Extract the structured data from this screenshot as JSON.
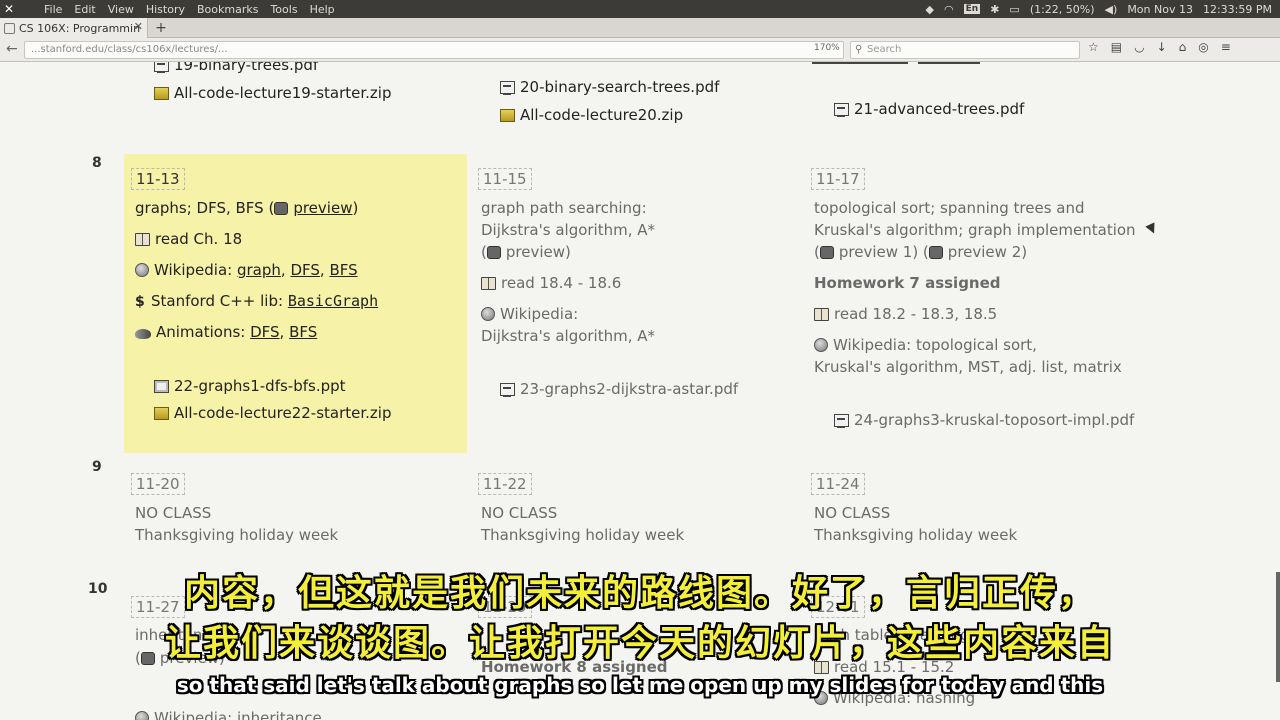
{
  "system": {
    "menu": [
      "File",
      "Edit",
      "View",
      "History",
      "Bookmarks",
      "Tools",
      "Help"
    ],
    "lang": "En",
    "battery": "(1:22, 50%)",
    "datetime": "Mon Nov 13",
    "clock": "12:33:59 PM"
  },
  "browser": {
    "tab_title": "CS 106X: Programmin",
    "url": "...stanford.edu/class/cs106x/lectures/...",
    "zoom": "170%",
    "search_placeholder": "Search"
  },
  "prev_row": {
    "c1_file1": "19-binary-trees.pdf",
    "c1_file2": "All-code-lecture19-starter.zip",
    "c2_file1": "20-binary-search-trees.pdf",
    "c2_file2": "All-code-lecture20.zip",
    "c3_file1": "21-advanced-trees.pdf"
  },
  "week8": {
    "num": "8",
    "c1": {
      "date": "11-13",
      "topic_pre": "graphs; DFS, BFS (",
      "preview": "preview",
      "topic_post": ")",
      "read": "read Ch. 18",
      "wiki_label": "Wikipedia: ",
      "wiki_graph": "graph",
      "wiki_dfs": "DFS",
      "wiki_bfs": "BFS",
      "lib_label": "Stanford C++ lib: ",
      "lib_link": "BasicGraph",
      "anim_label": "Animations: ",
      "anim_dfs": "DFS",
      "anim_bfs": "BFS",
      "file1": "22-graphs1-dfs-bfs.ppt",
      "file2": "All-code-lecture22-starter.zip"
    },
    "c2": {
      "date": "11-15",
      "line1": "graph path searching:",
      "line2": "Dijkstra's algorithm, A*",
      "preview": "preview",
      "read": "read 18.4 - 18.6",
      "wiki1": "Wikipedia:",
      "wiki2": "Dijkstra's algorithm, A*",
      "file1": "23-graphs2-dijkstra-astar.pdf"
    },
    "c3": {
      "date": "11-17",
      "line1": "topological sort; spanning trees and",
      "line2": "Kruskal's algorithm; graph implementation",
      "preview1": "preview 1",
      "preview2": "preview 2",
      "hw": "Homework 7 assigned",
      "read": "read 18.2 - 18.3, 18.5",
      "wiki1": "Wikipedia: topological sort,",
      "wiki2": "Kruskal's algorithm, MST, adj. list, matrix",
      "file1": "24-graphs3-kruskal-toposort-impl.pdf"
    }
  },
  "week9": {
    "num": "9",
    "c1": {
      "date": "11-20",
      "l1": "NO CLASS",
      "l2": "Thanksgiving holiday week"
    },
    "c2": {
      "date": "11-22",
      "l1": "NO CLASS",
      "l2": "Thanksgiving holiday week"
    },
    "c3": {
      "date": "11-24",
      "l1": "NO CLASS",
      "l2": "Thanksgiving holiday week"
    }
  },
  "week10": {
    "num": "10",
    "c1": {
      "date": "11-27",
      "l1": "inheritance",
      "preview": "preview",
      "wiki": "Wikipedia: inheritance"
    },
    "c2": {
      "date": "11-29",
      "hw": "Homework 8 assigned"
    },
    "c3": {
      "date": "12-01",
      "l1": "hash tables; hashing",
      "read": "read 15.1 - 15.2",
      "wiki": "Wikipedia: hashing"
    }
  },
  "subtitles": {
    "cn1": "内容，但这就是我们未来的路线图。好了，言归正传，",
    "cn2": "让我们来谈谈图。让我打开今天的幻灯片，这些内容来自",
    "en": "so that said let's talk about graphs so let me open up my slides for today and this"
  },
  "colors": {
    "highlight": "#f6f3a8",
    "subtitle_cn": "#f3ee3b"
  }
}
